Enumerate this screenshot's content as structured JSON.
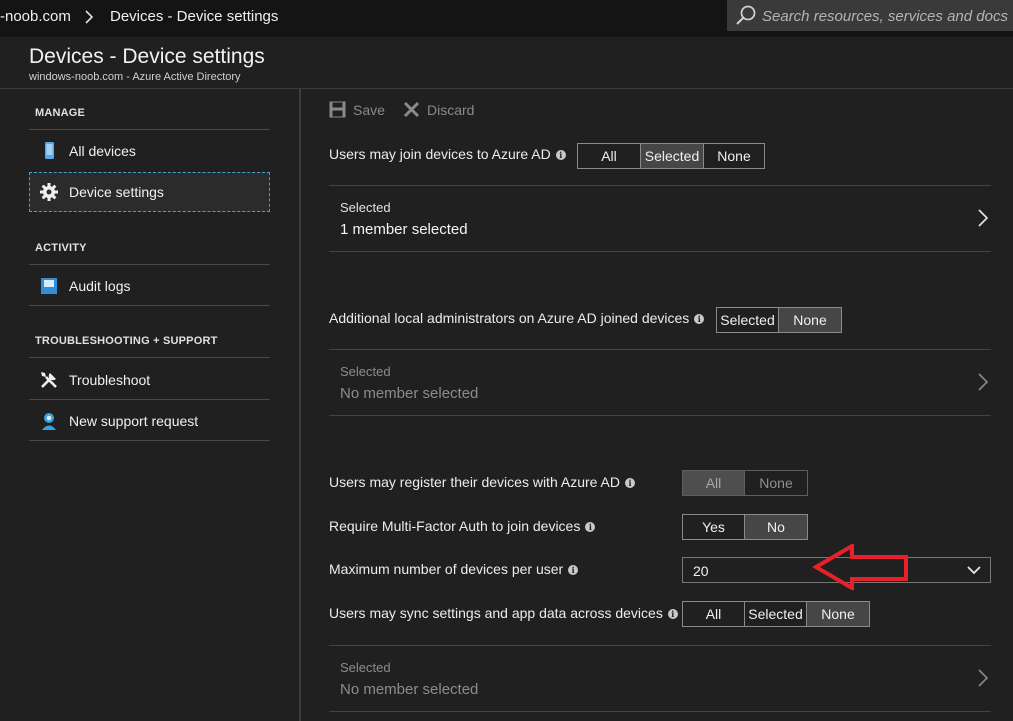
{
  "breadcrumb": {
    "root": "-noob.com",
    "current": "Devices - Device settings"
  },
  "search": {
    "placeholder": "Search resources, services and docs"
  },
  "blade": {
    "title": "Devices - Device settings",
    "subtitle": "windows-noob.com - Azure Active Directory"
  },
  "sidebar": {
    "manage_heading": "MANAGE",
    "activity_heading": "ACTIVITY",
    "support_heading": "TROUBLESHOOTING + SUPPORT",
    "items": [
      {
        "label": "All devices",
        "icon": "device-icon"
      },
      {
        "label": "Device settings",
        "icon": "gear-icon",
        "active": true
      },
      {
        "label": "Audit logs",
        "icon": "audit-log-icon"
      },
      {
        "label": "Troubleshoot",
        "icon": "tools-icon"
      },
      {
        "label": "New support request",
        "icon": "support-person-icon"
      }
    ]
  },
  "toolbar": {
    "save_label": "Save",
    "discard_label": "Discard",
    "disabled": true
  },
  "settings": {
    "join": {
      "label": "Users may join devices to Azure AD",
      "options": [
        "All",
        "Selected",
        "None"
      ],
      "selected": "Selected",
      "picker_caption": "Selected",
      "picker_value": "1 member selected"
    },
    "local_admins": {
      "label": "Additional local administrators on Azure AD joined devices",
      "options": [
        "Selected",
        "None"
      ],
      "selected": "None",
      "picker_caption": "Selected",
      "picker_value": "No member selected"
    },
    "register": {
      "label": "Users may register their devices with Azure AD",
      "options": [
        "All",
        "None"
      ],
      "selected": "All",
      "disabled": true
    },
    "mfa": {
      "label": "Require Multi-Factor Auth to join devices",
      "options": [
        "Yes",
        "No"
      ],
      "selected": "No"
    },
    "max_devices": {
      "label": "Maximum number of devices per user",
      "value": "20"
    },
    "sync": {
      "label": "Users may sync settings and app data across devices",
      "options": [
        "All",
        "Selected",
        "None"
      ],
      "selected": "None",
      "picker_caption": "Selected",
      "picker_value": "No member selected"
    }
  },
  "colors": {
    "background": "#202020",
    "accent": "#3fa3d6",
    "annotation_arrow": "#e8202a"
  }
}
